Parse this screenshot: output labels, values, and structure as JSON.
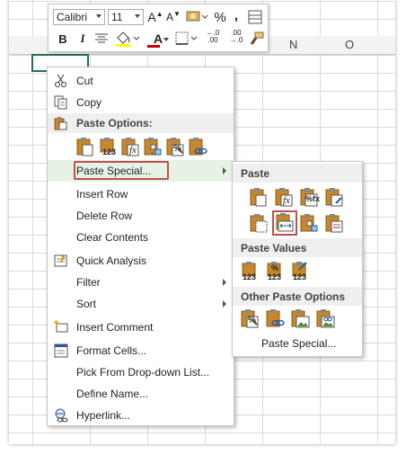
{
  "sheet": {
    "columns": [
      "N",
      "O"
    ]
  },
  "mini_toolbar": {
    "font_name": "Calibri",
    "font_size": "11",
    "bold": "B",
    "italic": "I",
    "percent": "%",
    "comma": ",",
    "font_color_letter": "A",
    "grow_font": "A",
    "shrink_font": "A",
    "increase_decimal": "←.0\n.00",
    "decrease_decimal": ".00\n→.0"
  },
  "context_menu": {
    "items": [
      {
        "label": "Cut",
        "icon": "scissors-icon"
      },
      {
        "label": "Copy",
        "icon": "copy-icon"
      },
      {
        "label": "Paste Options:",
        "icon": "paste-icon"
      },
      {
        "label": "Paste Special...",
        "submenu": true
      },
      {
        "label": "Insert Row"
      },
      {
        "label": "Delete Row"
      },
      {
        "label": "Clear Contents"
      },
      {
        "label": "Quick Analysis",
        "icon": "quick-analysis-icon"
      },
      {
        "label": "Filter",
        "submenu": true
      },
      {
        "label": "Sort",
        "submenu": true
      },
      {
        "label": "Insert Comment",
        "icon": "new-comment-icon"
      },
      {
        "label": "Format Cells...",
        "icon": "format-cells-icon"
      },
      {
        "label": "Pick From Drop-down List..."
      },
      {
        "label": "Define Name..."
      },
      {
        "label": "Hyperlink...",
        "icon": "hyperlink-icon"
      }
    ],
    "paste_option_labels": [
      "",
      "123",
      "fx",
      "",
      "%",
      ""
    ]
  },
  "paste_submenu": {
    "section_paste": "Paste",
    "section_values": "Paste Values",
    "section_other": "Other Paste Options",
    "footer": "Paste Special...",
    "value_labels": [
      "123",
      "123",
      "123"
    ],
    "formula_label": "fx",
    "percent_fx_label": "%fx"
  },
  "colors": {
    "excel_green": "#217346",
    "highlight_red": "#c0504d",
    "clipboard_orange": "#c8882a",
    "hover_bg": "#e6f2e6"
  }
}
